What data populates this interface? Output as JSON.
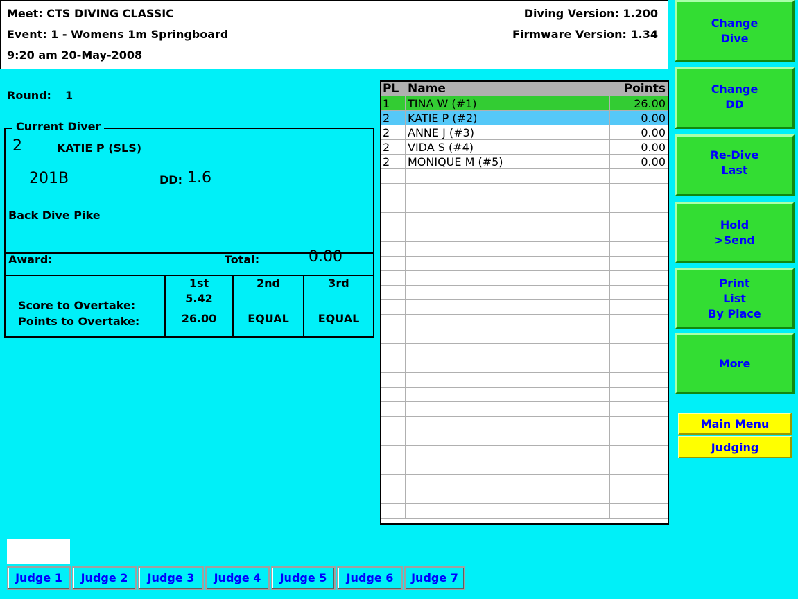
{
  "header": {
    "meet": "Meet: CTS DIVING CLASSIC",
    "event": "Event: 1 - Womens 1m Springboard",
    "datetime": "9:20 am 20-May-2008",
    "diving_version": "Diving Version: 1.200",
    "firmware_version": "Firmware Version: 1.34"
  },
  "round": {
    "label": "Round:",
    "value": "1"
  },
  "current_diver": {
    "legend": "Current Diver",
    "number": "2",
    "name": "KATIE P (SLS)",
    "dive_code": "201B",
    "dd_label": "DD:",
    "dd_value": "1.6",
    "description": "Back Dive Pike"
  },
  "award": {
    "label": "Award:",
    "total_label": "Total:",
    "total_value": "0.00"
  },
  "overtake": {
    "score_label": "Score to Overtake:",
    "points_label": "Points to Overtake:",
    "columns": [
      {
        "header": "1st",
        "score": "5.42",
        "points": "26.00"
      },
      {
        "header": "2nd",
        "score": "",
        "points": "EQUAL"
      },
      {
        "header": "3rd",
        "score": "",
        "points": "EQUAL"
      }
    ]
  },
  "standings": {
    "headers": {
      "pl": "PL",
      "name": "Name",
      "points": "Points"
    },
    "rows": [
      {
        "pl": "1",
        "name": "TINA W (#1)",
        "points": "26.00"
      },
      {
        "pl": "2",
        "name": "KATIE P (#2)",
        "points": "0.00"
      },
      {
        "pl": "2",
        "name": "ANNE J (#3)",
        "points": "0.00"
      },
      {
        "pl": "2",
        "name": "VIDA S (#4)",
        "points": "0.00"
      },
      {
        "pl": "2",
        "name": "MONIQUE M (#5)",
        "points": "0.00"
      }
    ]
  },
  "side_buttons": [
    {
      "label": "Change\nDive"
    },
    {
      "label": "Change\nDD"
    },
    {
      "label": "Re-Dive\nLast"
    },
    {
      "label": "Hold\n>Send"
    },
    {
      "label": "Print\nList\nBy Place"
    },
    {
      "label": "More"
    }
  ],
  "menu": {
    "main_menu": "Main Menu",
    "judging": "Judging"
  },
  "judges": [
    "Judge 1",
    "Judge 2",
    "Judge 3",
    "Judge 4",
    "Judge 5",
    "Judge 6",
    "Judge 7"
  ],
  "colors": {
    "background": "#00f0f8",
    "button_green": "#33dd33",
    "button_yellow": "#ffff00",
    "button_text": "#0000ff",
    "leader_row": "#33cc33",
    "current_row": "#55c8f8"
  }
}
